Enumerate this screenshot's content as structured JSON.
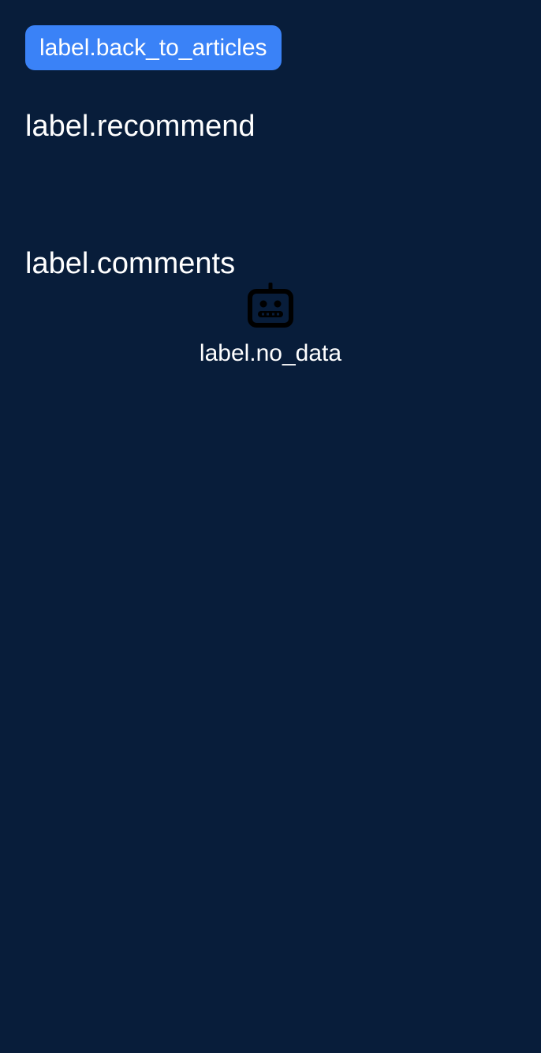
{
  "header": {
    "back_label": "label.back_to_articles"
  },
  "sections": {
    "recommend_title": "label.recommend",
    "comments_title": "label.comments"
  },
  "comments": {
    "empty_icon": "robot-icon",
    "empty_text": "label.no_data"
  },
  "colors": {
    "background": "#081d3a",
    "accent": "#3a82f7",
    "text": "#ffffff"
  }
}
